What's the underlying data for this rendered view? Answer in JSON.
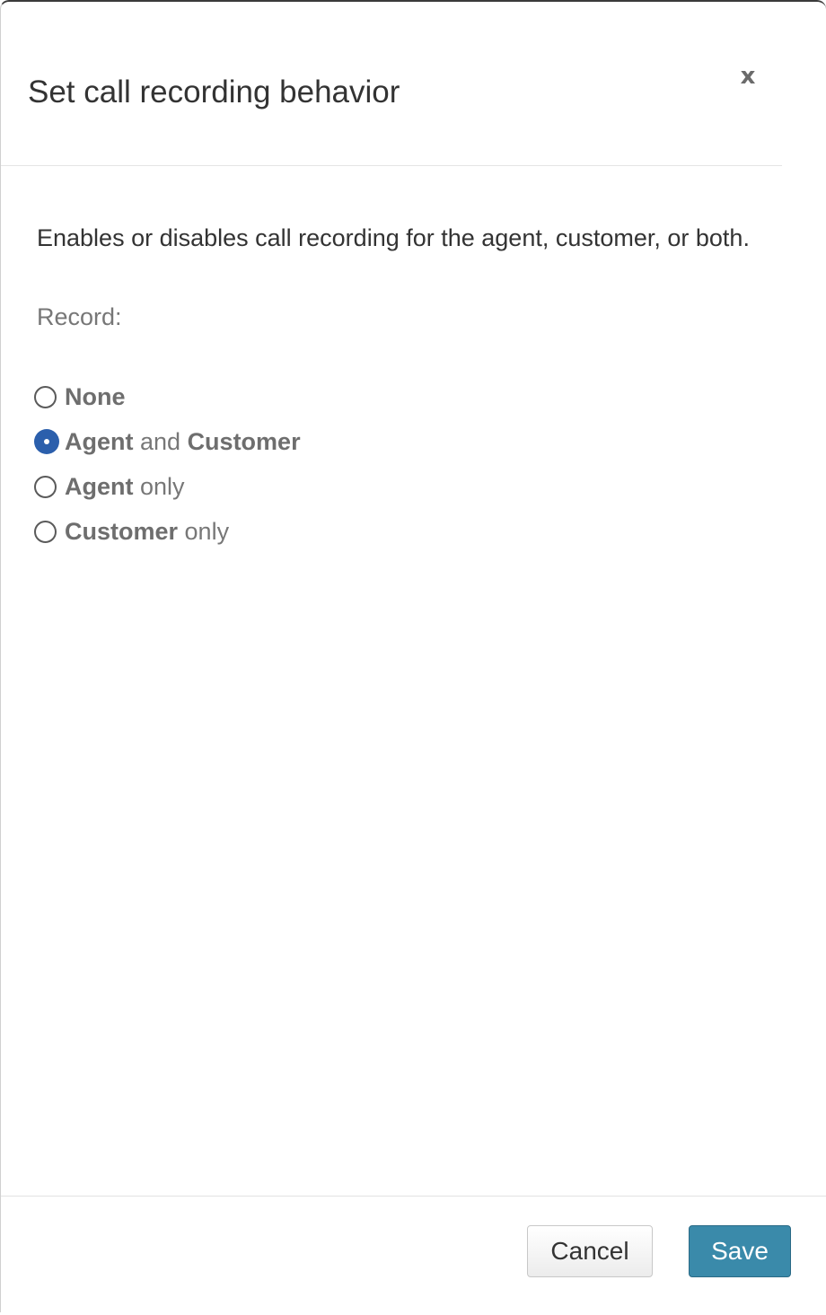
{
  "dialog": {
    "title": "Set call recording behavior",
    "close_label": "x"
  },
  "description": "Enables or disables call recording for the agent, customer, or both.",
  "record_label": "Record:",
  "options": [
    {
      "parts": [
        {
          "text": "None",
          "bold": true
        }
      ],
      "checked": false
    },
    {
      "parts": [
        {
          "text": "Agent",
          "bold": true
        },
        {
          "text": " and ",
          "bold": false
        },
        {
          "text": "Customer",
          "bold": true
        }
      ],
      "checked": true
    },
    {
      "parts": [
        {
          "text": "Agent",
          "bold": true
        },
        {
          "text": " only",
          "bold": false
        }
      ],
      "checked": false
    },
    {
      "parts": [
        {
          "text": "Customer",
          "bold": true
        },
        {
          "text": " only",
          "bold": false
        }
      ],
      "checked": false
    }
  ],
  "footer": {
    "cancel_label": "Cancel",
    "save_label": "Save"
  },
  "colors": {
    "accent": "#2b5fac",
    "save_button": "#3a8aaa"
  }
}
